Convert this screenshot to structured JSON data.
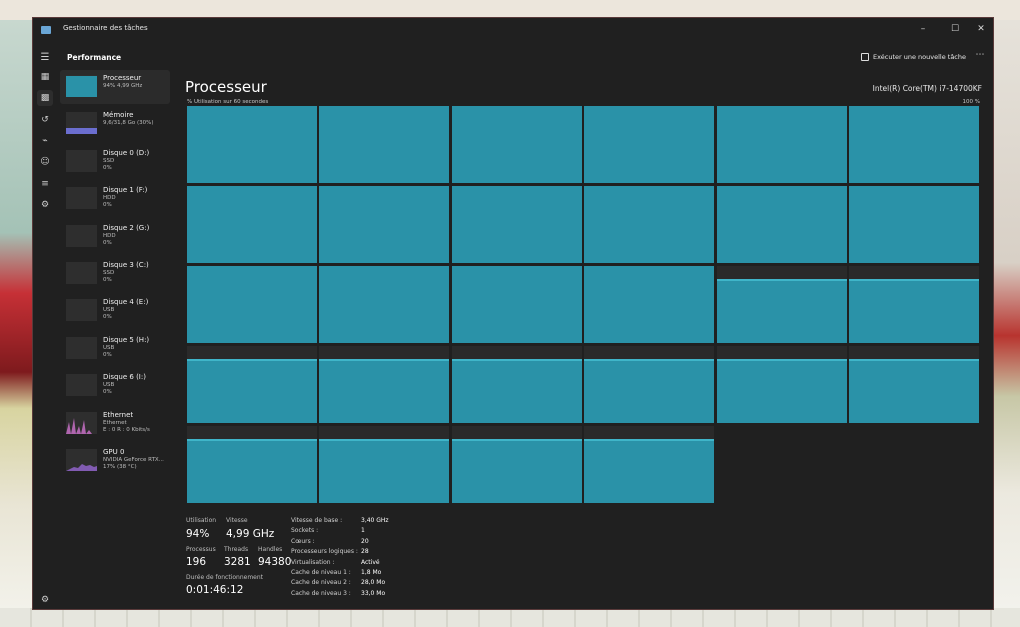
{
  "window": {
    "title": "Gestionnaire des tâches"
  },
  "header": {
    "section": "Performance",
    "run_task": "Exécuter une nouvelle tâche"
  },
  "nav_icons": [
    "hamburger-icon",
    "processes-icon",
    "performance-icon",
    "history-icon",
    "startup-icon",
    "users-icon",
    "details-icon",
    "services-icon",
    "settings-icon"
  ],
  "sidebar": {
    "items": [
      {
        "title": "Processeur",
        "sub": "94% 4,99 GHz",
        "sub2": "",
        "usage": 0.94,
        "color": "#2a92a8"
      },
      {
        "title": "Mémoire",
        "sub": "9,6/31,8 Go (30%)",
        "sub2": "",
        "usage": 0.3,
        "color": "#6b6ecf"
      },
      {
        "title": "Disque 0 (D:)",
        "sub": "SSD",
        "sub2": "0%",
        "usage": 0,
        "color": "#4a9e4a"
      },
      {
        "title": "Disque 1 (F:)",
        "sub": "HDD",
        "sub2": "0%",
        "usage": 0,
        "color": "#4a9e4a"
      },
      {
        "title": "Disque 2 (G:)",
        "sub": "HDD",
        "sub2": "0%",
        "usage": 0,
        "color": "#4a9e4a"
      },
      {
        "title": "Disque 3 (C:)",
        "sub": "SSD",
        "sub2": "0%",
        "usage": 0,
        "color": "#4a9e4a"
      },
      {
        "title": "Disque 4 (E:)",
        "sub": "USB",
        "sub2": "0%",
        "usage": 0,
        "color": "#4a9e4a"
      },
      {
        "title": "Disque 5 (H:)",
        "sub": "USB",
        "sub2": "0%",
        "usage": 0,
        "color": "#4a9e4a"
      },
      {
        "title": "Disque 6 (I:)",
        "sub": "USB",
        "sub2": "0%",
        "usage": 0,
        "color": "#4a9e4a"
      },
      {
        "title": "Ethernet",
        "sub": "Ethernet",
        "sub2": "E : 0 R : 0 Kbits/s",
        "usage": 0,
        "color": "#c66fc4"
      },
      {
        "title": "GPU 0",
        "sub": "NVIDIA GeForce RTX...",
        "sub2": "17% (38 °C)",
        "usage": 0.17,
        "color": "#8f63c9"
      }
    ]
  },
  "main": {
    "title": "Processeur",
    "model": "Intel(R) Core(TM) i7-14700KF",
    "axis_left": "% Utilisation sur 60 secondes",
    "axis_right": "100 %",
    "core_usage": [
      1,
      1,
      1,
      1,
      1,
      1,
      1,
      1,
      1,
      1,
      1,
      1,
      1,
      1,
      1,
      1,
      0.8,
      0.8,
      0.8,
      0.8,
      0.8,
      0.8,
      0.8,
      0.8,
      0.8,
      0.8,
      0.8,
      0.8
    ]
  },
  "stats": {
    "utilisation_label": "Utilisation",
    "utilisation_value": "94%",
    "vitesse_label": "Vitesse",
    "vitesse_value": "4,99 GHz",
    "processus_label": "Processus",
    "processus_value": "196",
    "threads_label": "Threads",
    "threads_value": "3281",
    "handles_label": "Handles",
    "handles_value": "94380",
    "uptime_label": "Durée de fonctionnement",
    "uptime_value": "0:01:46:12"
  },
  "specs": [
    {
      "k": "Vitesse de base :",
      "v": "3,40 GHz"
    },
    {
      "k": "Sockets :",
      "v": "1"
    },
    {
      "k": "Cœurs :",
      "v": "20"
    },
    {
      "k": "Processeurs logiques :",
      "v": "28"
    },
    {
      "k": "Virtualisation :",
      "v": "Activé"
    },
    {
      "k": "Cache de niveau 1 :",
      "v": "1,8 Mo"
    },
    {
      "k": "Cache de niveau 2 :",
      "v": "28,0 Mo"
    },
    {
      "k": "Cache de niveau 3 :",
      "v": "33,0 Mo"
    }
  ]
}
